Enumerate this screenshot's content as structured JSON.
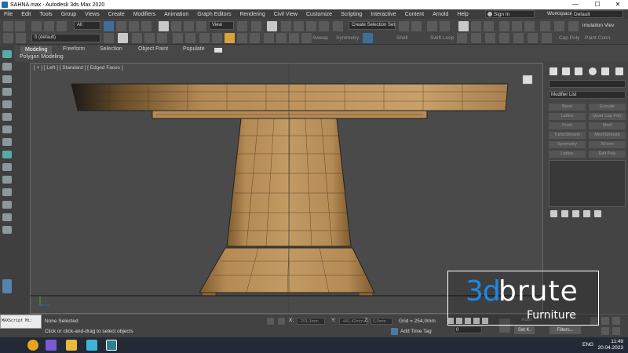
{
  "window": {
    "title": "SAHNA.max - Autodesk 3ds Max 2020",
    "minimize": "—",
    "maximize": "☐",
    "close": "✕"
  },
  "menu": {
    "items": [
      "File",
      "Edit",
      "Tools",
      "Group",
      "Views",
      "Create",
      "Modifiers",
      "Animation",
      "Graph Editors",
      "Rendering",
      "Civil View",
      "Customize",
      "Scripting",
      "Interactive",
      "Content",
      "Arnold",
      "Help"
    ],
    "sign_in": "Sign In",
    "workspaces_label": "Workspaces:",
    "workspace_value": "Default"
  },
  "toolbar": {
    "filter_value": "All",
    "layer_value": "0 (default)",
    "ref_coord": "View",
    "selection_set": "Create Selection Set",
    "simulation_label": "imulation Viev",
    "ribbon_tools": [
      "Sweep",
      "Symmetry",
      "Shell",
      "Swift Loop",
      "Cap Poly",
      "Paint Conn."
    ]
  },
  "ribbon": {
    "tabs": [
      "Modeling",
      "Freeform",
      "Selection",
      "Object Paint",
      "Populate"
    ],
    "active_tab": "Modeling",
    "subtitle": "Polygon Modeling"
  },
  "viewport": {
    "label": "[ + ] [ Left ] [ Standard ] [ Edged Faces ]"
  },
  "command_panel": {
    "modifier_list": "Modifier List",
    "modifier_buttons": [
      "Bend",
      "Extrude",
      "Lattice",
      "Quad Cap Poly",
      "Push",
      "Shell",
      "TurboSmooth",
      "MeshSmooth",
      "Symmetry",
      "XForm",
      "Lattice",
      "Edit Poly"
    ]
  },
  "status": {
    "maxscript": "MAXScript Mi:",
    "selection": "None Selected",
    "prompt": "Click or click-and-drag to select objects",
    "x_label": "X:",
    "x_value": "-291,3mm",
    "y_label": "Y:",
    "y_value": "-441,42mm",
    "z_label": "Z:",
    "z_value": "0,0mm",
    "grid": "Grid = 254,0mm",
    "add_time_tag": "Add Time Tag",
    "frame_value": "0",
    "set_k": "Set K.",
    "filters": "Filters...",
    "auto": "Auto"
  },
  "taskbar": {
    "lang": "ENG",
    "time": "11:49",
    "date": "20.04.2023"
  },
  "watermark": {
    "brand_3d": "3d",
    "brand_rest": "brute",
    "sub": "Furniture"
  },
  "colors": {
    "accent": "#1e88e5",
    "wood": "#b48a55",
    "bg": "#4a4a4a"
  }
}
